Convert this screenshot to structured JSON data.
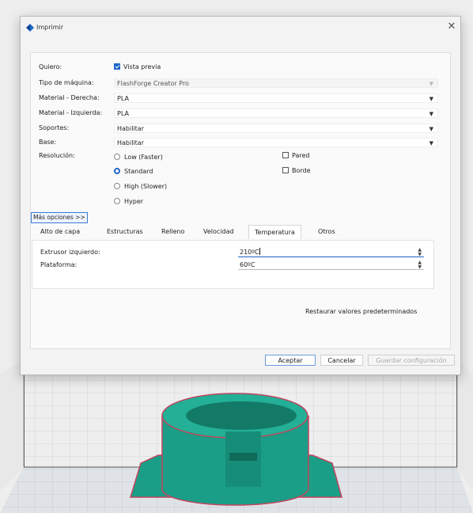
{
  "dialog": {
    "title": "Imprimir",
    "close_glyph": "✕",
    "icon": "app-logo-icon"
  },
  "form": {
    "quiero": {
      "label": "Quiero:",
      "option_label": "Vista previa",
      "checked": true
    },
    "tipo_maquina": {
      "label": "Tipo de máquina:",
      "value": "FlashForge Creator Pro",
      "enabled": false
    },
    "material_derecha": {
      "label": "Material - Derecha:",
      "value": "PLA"
    },
    "material_izquierda": {
      "label": "Material - Izquierda:",
      "value": "PLA"
    },
    "soportes": {
      "label": "Soportes:",
      "value": "Habilitar"
    },
    "base": {
      "label": "Base:",
      "value": "Habilitar"
    },
    "resolucion": {
      "label": "Resolución:",
      "options": [
        "Low (Faster)",
        "Standard",
        "High (Slower)",
        "Hyper"
      ],
      "selected": "Standard"
    },
    "pared": {
      "label": "Pared",
      "checked": false
    },
    "borde": {
      "label": "Borde",
      "checked": false
    }
  },
  "more_options_label": "Más opciones >>",
  "tabs": [
    {
      "label": "Alto de capa"
    },
    {
      "label": "Estructuras"
    },
    {
      "label": "Relleno"
    },
    {
      "label": "Velocidad"
    },
    {
      "label": "Temperatura"
    },
    {
      "label": "Otros"
    }
  ],
  "active_tab": "Temperatura",
  "temperature": {
    "extrusor_label": "Extrusor izquierdo:",
    "extrusor_value": "210ºC",
    "plataforma_label": "Plataforma:",
    "plataforma_value": "60ºC"
  },
  "restore_label": "Restaurar valores predeterminados",
  "buttons": {
    "ok": "Aceptar",
    "cancel": "Cancelar",
    "save": "Guardar configuración"
  },
  "colors": {
    "accent": "#1f66c8",
    "model": "#1b9e87",
    "model_dark": "#127a68",
    "model_outline": "#c0455f"
  }
}
